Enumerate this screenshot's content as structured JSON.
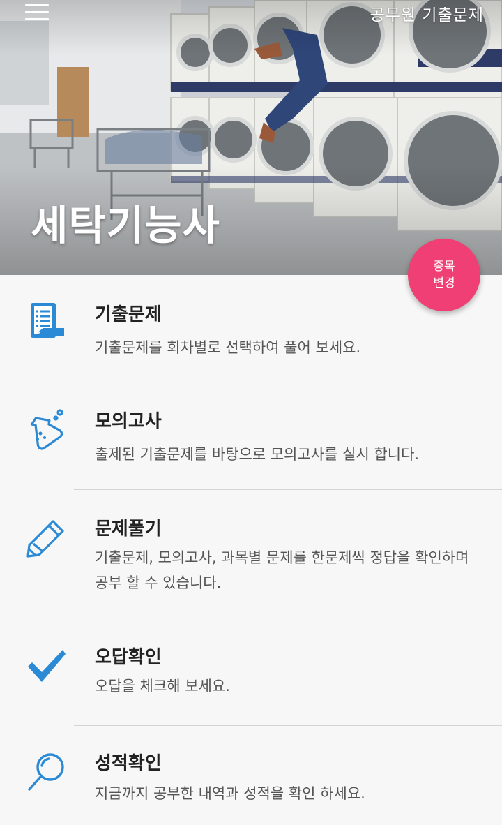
{
  "header": {
    "app_title": "공무원 기출문제",
    "subject": "세탁기능사",
    "menu_icon": "hamburger-menu-icon"
  },
  "fab": {
    "line1": "종목",
    "line2": "변경"
  },
  "colors": {
    "accent": "#2b8ad6",
    "fab": "#f03f74",
    "title_text": "#222222",
    "desc_text": "#555555"
  },
  "menu": {
    "items": [
      {
        "icon": "document-list-icon",
        "title": "기출문제",
        "desc": "기출문제를 회차별로 선택하여 풀어 보세요."
      },
      {
        "icon": "flask-icon",
        "title": "모의고사",
        "desc": "출제된 기출문제를 바탕으로 모의고사를 실시 합니다."
      },
      {
        "icon": "pencil-icon",
        "title": "문제풀기",
        "desc": "기출문제, 모의고사, 과목별 문제를 한문제씩 정답을 확인하며 공부 할 수 있습니다."
      },
      {
        "icon": "checkmark-icon",
        "title": "오답확인",
        "desc": "오답을 체크해 보세요."
      },
      {
        "icon": "magnifier-icon",
        "title": "성적확인",
        "desc": "지금까지 공부한 내역과 성적을 확인 하세요."
      }
    ]
  }
}
